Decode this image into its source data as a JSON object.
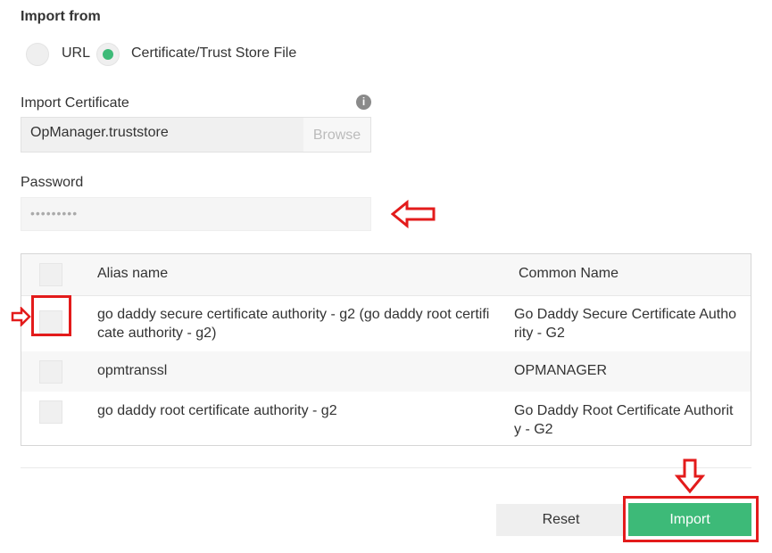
{
  "import_from": {
    "label": "Import from",
    "options": [
      {
        "label": "URL",
        "selected": false
      },
      {
        "label": "Certificate/Trust Store File",
        "selected": true
      }
    ]
  },
  "certificate": {
    "label": "Import Certificate",
    "value": "OpManager.truststore",
    "browse": "Browse"
  },
  "password": {
    "label": "Password",
    "value": "•••••••••"
  },
  "table": {
    "headers": [
      "Alias name",
      "Common Name"
    ],
    "rows": [
      {
        "alias": "go daddy secure certificate authority - g2 (go daddy root certificate authority - g2)",
        "common": "Go Daddy Secure Certificate Authority - G2"
      },
      {
        "alias": "opmtranssl",
        "common": "OPMANAGER"
      },
      {
        "alias": "go daddy root certificate authority - g2",
        "common": "Go Daddy Root Certificate Authority - G2"
      }
    ]
  },
  "buttons": {
    "reset": "Reset",
    "import": "Import"
  },
  "colors": {
    "accent": "#3dba78",
    "annotation": "#e31b1b"
  }
}
